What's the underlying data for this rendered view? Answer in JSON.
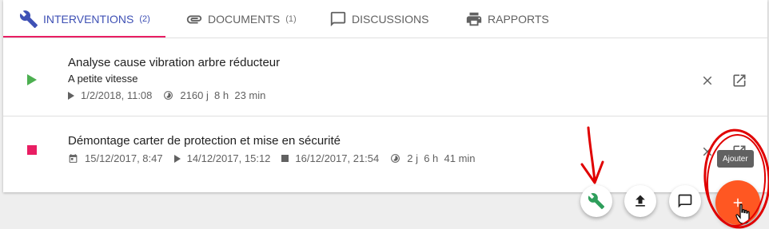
{
  "colors": {
    "primary": "#3f51b5",
    "tab_indicator": "#e91e63",
    "status_running": "#4caf50",
    "status_stopped": "#e91e63",
    "fab": "#ff5722",
    "annotation": "#e00000",
    "wrench_green": "#2e9e5b"
  },
  "tabs": [
    {
      "label": "INTERVENTIONS",
      "count": "(2)",
      "icon": "wrench-icon",
      "active": true
    },
    {
      "label": "DOCUMENTS",
      "count": "(1)",
      "icon": "attachment-icon",
      "active": false
    },
    {
      "label": "DISCUSSIONS",
      "count": "",
      "icon": "comment-icon",
      "active": false
    },
    {
      "label": "RAPPORTS",
      "count": "",
      "icon": "print-icon",
      "active": false
    }
  ],
  "interventions": [
    {
      "title": "Analyse cause vibration arbre réducteur",
      "subtitle": "A petite vitesse",
      "status_icon": "play-icon",
      "start": "1/2/2018, 11:08",
      "duration": "2160 j  8 h  23 min"
    },
    {
      "title": "Démontage carter de protection et mise en sécurité",
      "status_icon": "stop-icon",
      "planned": "15/12/2017, 8:47",
      "start": "14/12/2017, 15:12",
      "end": "16/12/2017, 21:54",
      "duration": "2 j  6 h  41 min"
    }
  ],
  "row_actions": {
    "close_icon": "close-icon",
    "open_icon": "open-in-new-icon"
  },
  "fab_actions": [
    {
      "icon": "wrench-icon"
    },
    {
      "icon": "upload-icon"
    },
    {
      "icon": "comment-icon"
    }
  ],
  "fab_main": {
    "icon": "plus-icon",
    "tooltip": "Ajouter"
  }
}
